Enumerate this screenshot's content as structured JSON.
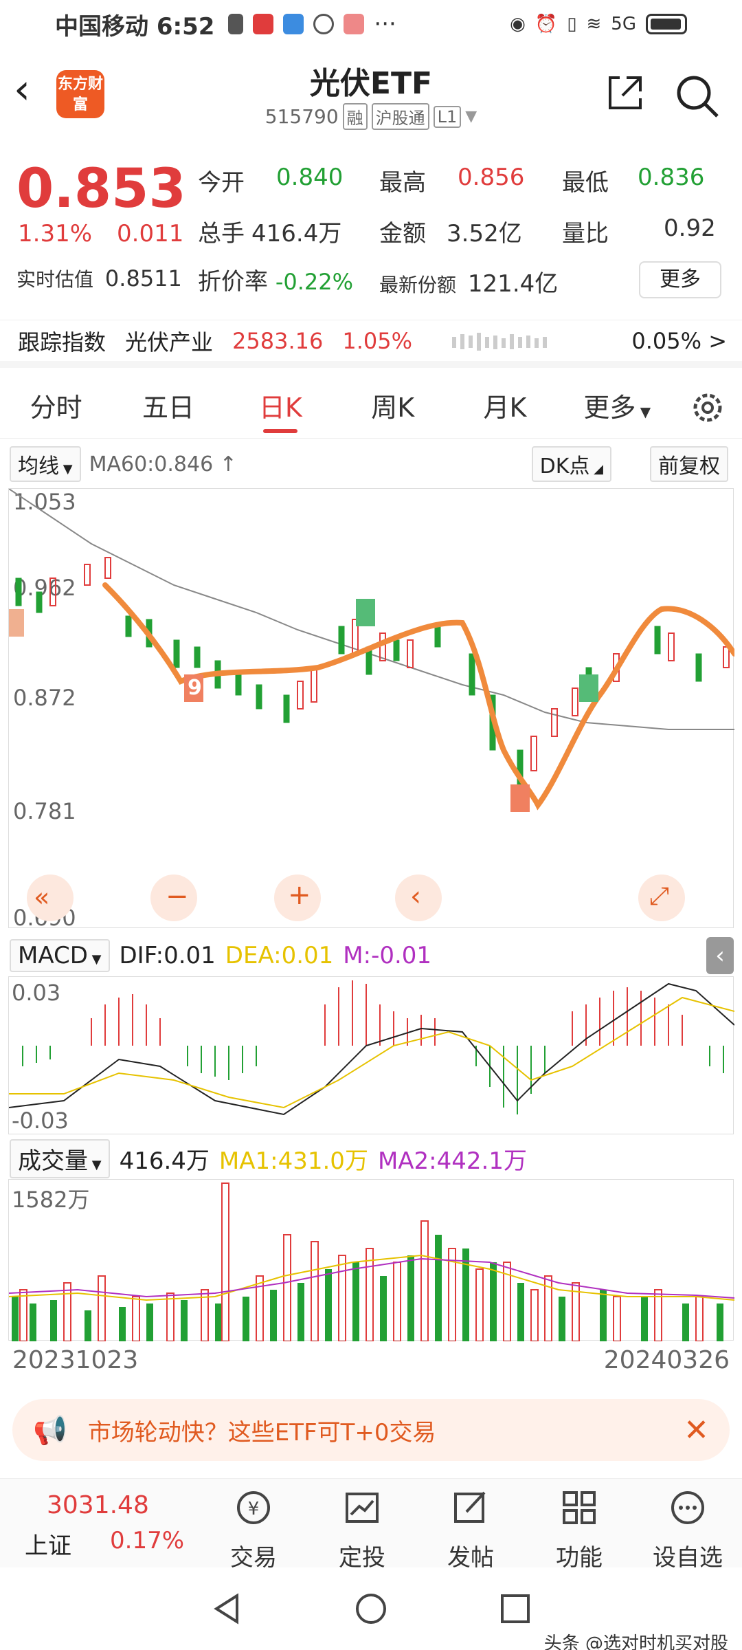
{
  "status": {
    "carrier_time": "中国移动 6:52",
    "dots": "···",
    "signal": "5G"
  },
  "header": {
    "logo_text": "东方财富",
    "title": "光伏ETF",
    "code": "515790",
    "tags": [
      "融",
      "沪股通",
      "L1"
    ]
  },
  "quote": {
    "price": "0.853",
    "pct": "1.31%",
    "chg": "0.011",
    "open_label": "今开",
    "open": "0.840",
    "high_label": "最高",
    "high": "0.856",
    "low_label": "最低",
    "low": "0.836",
    "hands_label": "总手",
    "hands": "416.4万",
    "amount_label": "金额",
    "amount": "3.52亿",
    "ratio_label": "量比",
    "ratio": "0.92",
    "iopv_label": "实时估值",
    "iopv": "0.8511",
    "discount_label": "折价率",
    "discount": "-0.22%",
    "shares_label": "最新份额",
    "shares": "121.4亿",
    "more_label": "更多"
  },
  "track": {
    "label": "跟踪指数",
    "index": "光伏产业",
    "value": "2583.16",
    "pct": "1.05%",
    "deviation": "0.05% >"
  },
  "tabs": [
    "分时",
    "五日",
    "日K",
    "周K",
    "月K",
    "更多"
  ],
  "ma_bar": {
    "selector": "均线",
    "ma60": "MA60:0.846 ↑",
    "dk": "DK点",
    "adjust": "前复权"
  },
  "kchart": {
    "y_labels": [
      "1.053",
      "0.962",
      "0.872",
      "0.781",
      "0.690"
    ],
    "marker_9": "9"
  },
  "macd": {
    "selector": "MACD",
    "dif": "DIF:0.01",
    "dea": "DEA:0.01",
    "m": "M:-0.01",
    "top": "0.03",
    "bottom": "-0.03"
  },
  "volume": {
    "selector": "成交量",
    "value": "416.4万",
    "ma1": "MA1:431.0万",
    "ma2": "MA2:442.1万",
    "top": "1582万"
  },
  "dates": {
    "start": "20231023",
    "end": "20240326"
  },
  "banner": {
    "text": "市场轮动快？这些ETF可T+0交易"
  },
  "bottom_nav": {
    "index_value": "3031.48",
    "index_name": "上证",
    "index_pct": "0.17%",
    "items": [
      "交易",
      "定投",
      "发帖",
      "功能",
      "设自选"
    ]
  },
  "watermark": "头条 @选对时机买对股",
  "colors": {
    "up": "#e03c3c",
    "down": "#22a034",
    "ma60": "#888888",
    "dea": "#e6c200",
    "m": "#b030c0",
    "annotation": "#f08a3c"
  }
}
